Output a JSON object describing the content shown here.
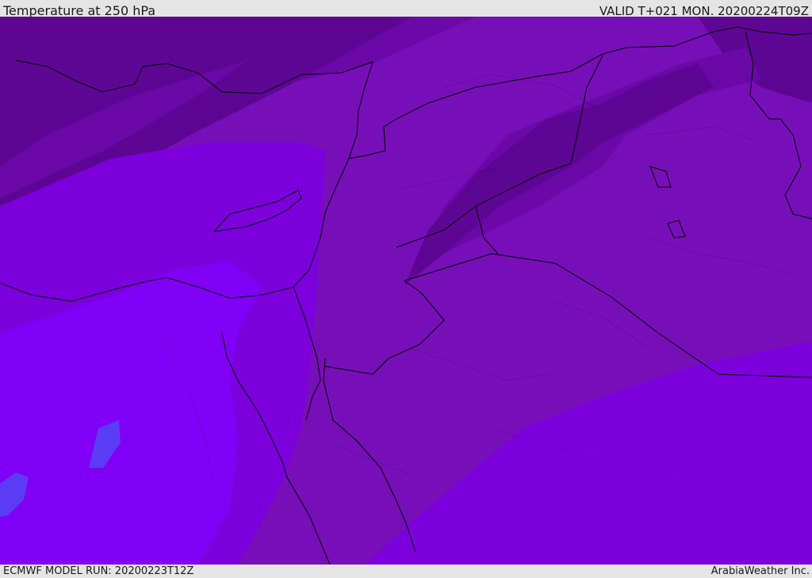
{
  "header": {
    "title": "Temperature at 250 hPa",
    "valid": "VALID T+021 MON. 20200224T09Z"
  },
  "footer": {
    "model_run": "ECMWF MODEL RUN: 20200223T12Z",
    "credit": "ArabiaWeather Inc."
  },
  "map": {
    "colors": {
      "band_coldest": "#5e0694",
      "band_cold": "#6a08a8",
      "band_mid": "#770fb8",
      "band_warm": "#7c00dc",
      "band_warmer": "#8000f6",
      "band_warmest": "#5a3cf4",
      "coastline": "#000000"
    }
  }
}
